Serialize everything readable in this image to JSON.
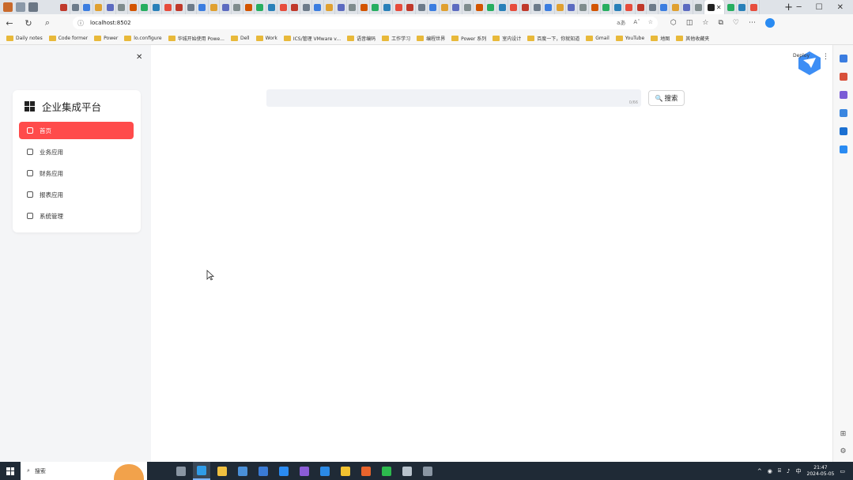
{
  "browser": {
    "url": "localhost:8502",
    "url_tools": [
      "aあ",
      "Aˆ",
      "☆"
    ],
    "bookmarks": [
      "Daily notes",
      "Code former",
      "Power",
      "lo.configure",
      "华城开始使用 Powe...",
      "Dell",
      "Work",
      "ICS/管理 VMware v...",
      "语音编码",
      "工作学习",
      "编程世界",
      "Power 系列",
      "室内设计",
      "百度一下，你就知道",
      "Gmail",
      "YouTube",
      "地图",
      "其他收藏夹"
    ]
  },
  "sidebar": {
    "brand": "企业集成平台",
    "items": [
      {
        "label": "首页",
        "icon": "home-icon",
        "active": true
      },
      {
        "label": "业务应用",
        "icon": "people-icon",
        "active": false
      },
      {
        "label": "财务应用",
        "icon": "star-icon",
        "active": false
      },
      {
        "label": "报表应用",
        "icon": "report-icon",
        "active": false
      },
      {
        "label": "系统管理",
        "icon": "settings-icon",
        "active": false
      }
    ]
  },
  "main": {
    "search_count": "0/66",
    "search_button": "搜索"
  },
  "header": {
    "deploy_label": "Deploy"
  },
  "taskbar": {
    "search_placeholder": "搜索",
    "tray_lang": "中",
    "time": "21:47",
    "date": "2024-05-05"
  },
  "colors": {
    "accent": "#ff4b4b",
    "sidebar_bg": "#f4f5f7",
    "search_bg": "#f0f2f6",
    "taskbar_bg": "#1f2a36"
  }
}
